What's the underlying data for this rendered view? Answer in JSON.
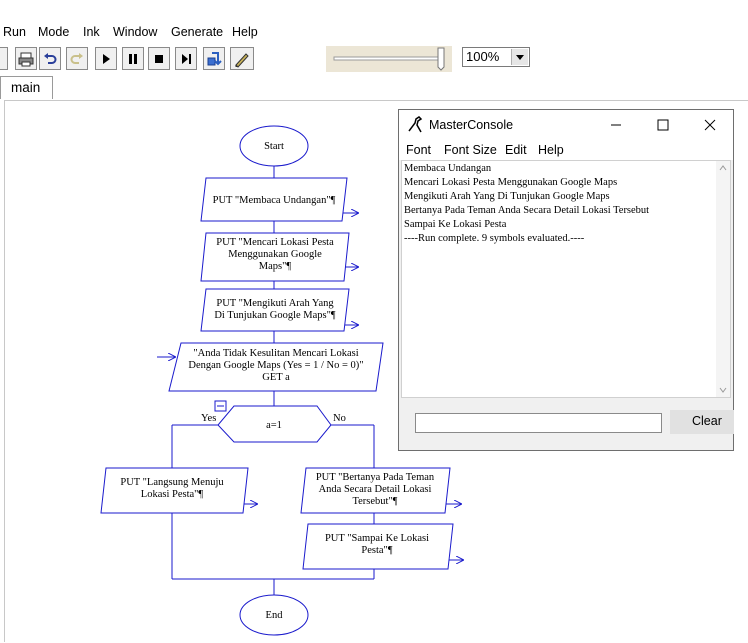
{
  "menubar": {
    "run": "Run",
    "mode": "Mode",
    "ink": "Ink",
    "window": "Window",
    "generate": "Generate",
    "help": "Help"
  },
  "toolbar": {
    "buttons": [
      "printer-icon",
      "undo-icon",
      "redo-icon",
      "play-icon",
      "pause-icon",
      "stop-icon",
      "step-icon",
      "debug-icon",
      "pen-icon"
    ],
    "zoom_value": "100%"
  },
  "tabs": {
    "main": "main"
  },
  "flowchart": {
    "start": "Start",
    "end": "End",
    "step1": [
      "PUT \"Membaca Undangan\"¶"
    ],
    "step2": [
      "PUT \"Mencari Lokasi Pesta",
      "Menggunakan Google",
      "Maps\"¶"
    ],
    "step3": [
      "PUT \"Mengikuti Arah Yang",
      "Di Tunjukan Google Maps\"¶"
    ],
    "input": [
      "\"Anda Tidak Kesulitan Mencari Lokasi",
      "Dengan Google Maps (Yes = 1 / No = 0)\"",
      "GET a"
    ],
    "decision": "a=1",
    "yes_label": "Yes",
    "no_label": "No",
    "yes_step": [
      "PUT \"Langsung Menuju",
      "Lokasi Pesta\"¶"
    ],
    "no_step1": [
      "PUT \"Bertanya Pada Teman",
      "Anda Secara Detail Lokasi",
      "Tersebut\"¶"
    ],
    "no_step2": [
      "PUT \"Sampai Ke Lokasi",
      "Pesta\"¶"
    ]
  },
  "console": {
    "title": "MasterConsole",
    "menu": {
      "font": "Font",
      "font_size": "Font Size",
      "edit": "Edit",
      "help": "Help"
    },
    "output": [
      "Membaca Undangan",
      "Mencari Lokasi Pesta Menggunakan Google Maps",
      "Mengikuti Arah Yang Di Tunjukan Google Maps",
      "Bertanya Pada Teman Anda Secara Detail Lokasi Tersebut",
      "Sampai Ke Lokasi Pesta",
      "----Run complete.  9 symbols evaluated.----"
    ],
    "input_value": "",
    "clear_label": "Clear"
  },
  "colors": {
    "flow_stroke": "#1a1acc",
    "flow_line": "#1a1acc"
  }
}
